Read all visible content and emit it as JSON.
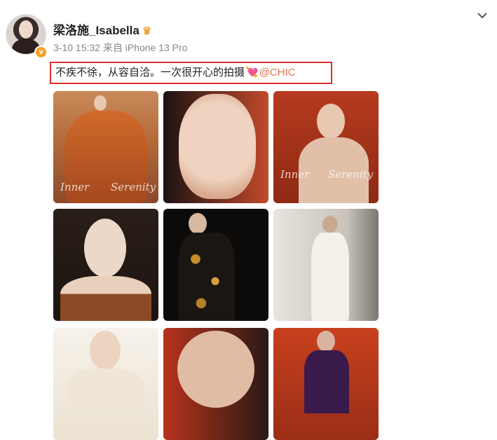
{
  "post": {
    "author": "梁洛施_Isabella",
    "crown_icon": "crown-icon",
    "meta": "3-10 15:32 来自 iPhone 13 Pro",
    "text_main": "不疾不徐，从容自洽。一次很开心的拍摄",
    "heart_icon": "💘",
    "mention": "@CHIC",
    "verified_badge": "v"
  },
  "photos": [
    {
      "caption_left": "Inner",
      "caption_right": "Serenity"
    },
    {},
    {
      "caption_left": "Inner",
      "caption_right": "Serenity"
    },
    {},
    {},
    {},
    {},
    {},
    {}
  ],
  "colors": {
    "highlight_border": "#d8322f",
    "mention": "#eb7350",
    "meta_text": "#888888"
  }
}
